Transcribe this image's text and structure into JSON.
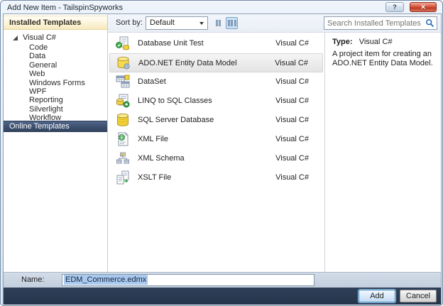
{
  "window": {
    "title": "Add New Item - TailspinSpyworks",
    "help_label": "?",
    "close_label": "✕",
    "help_icon": "help-icon",
    "close_icon": "close-icon"
  },
  "sidebar": {
    "installed_header": "Installed Templates",
    "online_header": "Online Templates",
    "tree_root": "Visual C#",
    "tree_root_expander": "expanded-triangle-icon",
    "tree_items": [
      "Code",
      "Data",
      "General",
      "Web",
      "Windows Forms",
      "WPF",
      "Reporting",
      "Silverlight",
      "Workflow"
    ]
  },
  "toolbar": {
    "sort_by_label": "Sort by:",
    "sort_value": "Default",
    "view_buttons": [
      "medium-icons-view-icon",
      "small-icons-view-icon"
    ],
    "active_view": "small-icons-view-icon"
  },
  "search": {
    "placeholder": "Search Installed Templates",
    "icon": "search-icon"
  },
  "templates": [
    {
      "name": "Database Unit Test",
      "language": "Visual C#",
      "icon": "database-unit-test-icon",
      "selected": false
    },
    {
      "name": "ADO.NET Entity Data Model",
      "language": "Visual C#",
      "icon": "entity-data-model-icon",
      "selected": true
    },
    {
      "name": "DataSet",
      "language": "Visual C#",
      "icon": "dataset-icon",
      "selected": false
    },
    {
      "name": "LINQ to SQL Classes",
      "language": "Visual C#",
      "icon": "linq-to-sql-icon",
      "selected": false
    },
    {
      "name": "SQL Server Database",
      "language": "Visual C#",
      "icon": "sql-server-database-icon",
      "selected": false
    },
    {
      "name": "XML File",
      "language": "Visual C#",
      "icon": "xml-file-icon",
      "selected": false
    },
    {
      "name": "XML Schema",
      "language": "Visual C#",
      "icon": "xml-schema-icon",
      "selected": false
    },
    {
      "name": "XSLT File",
      "language": "Visual C#",
      "icon": "xslt-file-icon",
      "selected": false
    }
  ],
  "details": {
    "type_label": "Type:",
    "type_value": "Visual C#",
    "description": "A project item for creating an ADO.NET Entity Data Model."
  },
  "footer": {
    "name_label": "Name:",
    "name_value": "EDM_Commerce.edmx",
    "add_label": "Add",
    "cancel_label": "Cancel"
  },
  "colors": {
    "online_header_bg": "#3c4f6e",
    "installed_header_bg": "#f9eecb",
    "footer_bg": "#24344b",
    "selection_bg": "#a9c9ee",
    "add_button_border": "#3c7fb1",
    "close_button_red": "#c03a22",
    "strip_bg": "#eef2f8"
  }
}
